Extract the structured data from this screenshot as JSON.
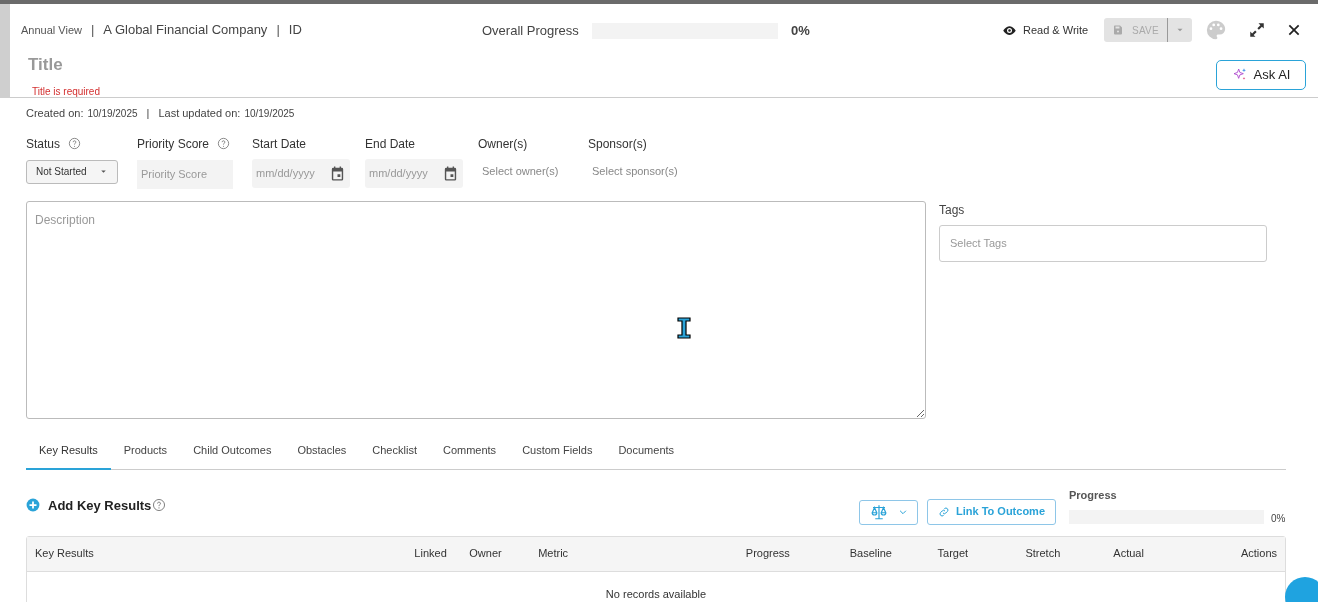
{
  "header": {
    "breadcrumb": [
      "Annual View",
      "A Global Financial Company",
      "ID"
    ],
    "breadcrumb_separators": [
      "|",
      "|"
    ],
    "progress_label": "Overall Progress",
    "progress": {
      "level": 0
    },
    "progress_reading": "0%",
    "access": "Read & Write",
    "save": {
      "label": "SAVE",
      "disabled": true
    }
  },
  "title": {
    "placeholder": "Title",
    "error": "Title is required"
  },
  "ask_ai": "Ask AI",
  "meta": {
    "created_label": "Created on:",
    "created": "10/19/2025",
    "separator": "|",
    "updated_label": "Last updated on:",
    "updated": "10/19/2025"
  },
  "fields": [
    {
      "kind": "select",
      "label": "Status",
      "help": true,
      "value": "Not Started"
    },
    {
      "kind": "input",
      "label": "Priority Score",
      "help": true,
      "placeholder": "Priority Score"
    },
    {
      "kind": "date",
      "label": "Start Date",
      "help": false,
      "placeholder": "mm/dd/yyyy"
    },
    {
      "kind": "date",
      "label": "End Date",
      "help": false,
      "placeholder": "mm/dd/yyyy"
    },
    {
      "kind": "picker",
      "label": "Owner(s)",
      "help": false,
      "placeholder": "Select owner(s)"
    },
    {
      "kind": "picker",
      "label": "Sponsor(s)",
      "help": false,
      "placeholder": "Select sponsor(s)"
    }
  ],
  "description": {
    "placeholder": "Description"
  },
  "tags": {
    "label": "Tags",
    "placeholder": "Select Tags"
  },
  "tabs": [
    {
      "label": "Key Results",
      "selected": true
    },
    {
      "label": "Products",
      "selected": false
    },
    {
      "label": "Child Outcomes",
      "selected": false
    },
    {
      "label": "Obstacles",
      "selected": false
    },
    {
      "label": "Checklist",
      "selected": false
    },
    {
      "label": "Comments",
      "selected": false
    },
    {
      "label": "Custom Fields",
      "selected": false
    },
    {
      "label": "Documents",
      "selected": false
    }
  ],
  "key_results": {
    "add_label": "Add Key Results",
    "link_button": "Link To Outcome",
    "progress_label": "Progress",
    "progress": {
      "level": 0
    },
    "progress_reading": "0%",
    "table": {
      "columns": [
        "Key Results",
        "Linked",
        "Owner",
        "Metric",
        "Progress",
        "Baseline",
        "Target",
        "Stretch",
        "Actual",
        "Actions"
      ],
      "empty": "No records available"
    }
  }
}
